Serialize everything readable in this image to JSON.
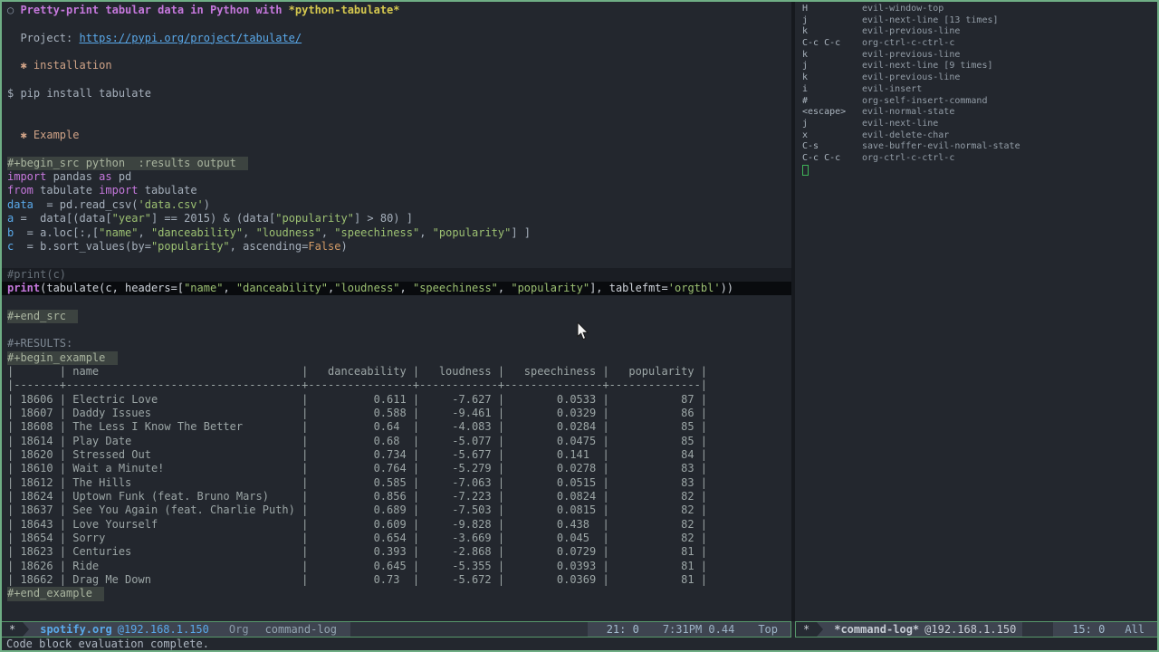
{
  "colors": {
    "background": "#23272e",
    "frame_border": "#6fae85",
    "modeline_bg": "#3e4450",
    "modeline_border": "#57996b",
    "accent_blue": "#5aa9ea",
    "heading_magenta": "#c678dd",
    "string_green": "#9cc072",
    "highlight_yellow": "#d6c94f",
    "cursor_green": "#3fb458"
  },
  "org_buffer": {
    "lines": [
      {
        "s": [
          [
            "bullet",
            "○ "
          ],
          [
            "h1",
            "Pretty-print tabular data in Python with "
          ],
          [
            "yel",
            "*python-tabulate*"
          ]
        ]
      },
      {},
      {
        "s": [
          [
            "t",
            "  Project: "
          ],
          [
            "lnk",
            "https://pypi.org/project/tabulate/"
          ]
        ]
      },
      {},
      {
        "s": [
          [
            "h2",
            "  ✱ installation"
          ]
        ]
      },
      {},
      {
        "s": [
          [
            "t",
            "$ pip install tabulate"
          ]
        ]
      },
      {},
      {},
      {
        "s": [
          [
            "h2",
            "  ✱ Example"
          ]
        ]
      },
      {},
      {
        "chip": "#+begin_src python  :results output "
      },
      {
        "s": [
          [
            "kw",
            "import"
          ],
          [
            "t",
            " pandas "
          ],
          [
            "kw",
            "as"
          ],
          [
            "t",
            " pd"
          ]
        ]
      },
      {
        "s": [
          [
            "kw",
            "from"
          ],
          [
            "t",
            " tabulate "
          ],
          [
            "kw",
            "import"
          ],
          [
            "t",
            " tabulate"
          ]
        ]
      },
      {
        "s": [
          [
            "var",
            "data"
          ],
          [
            "t",
            "  = pd.read_csv("
          ],
          [
            "str",
            "'data.csv'"
          ],
          [
            "t",
            ")"
          ]
        ]
      },
      {
        "s": [
          [
            "var",
            "a"
          ],
          [
            "t",
            " =  data[(data["
          ],
          [
            "str",
            "\"year\""
          ],
          [
            "t",
            "] == 2015) & (data["
          ],
          [
            "str",
            "\"popularity\""
          ],
          [
            "t",
            "] > 80) ]"
          ]
        ]
      },
      {
        "s": [
          [
            "var",
            "b"
          ],
          [
            "t",
            "  = a.loc[:,["
          ],
          [
            "str",
            "\"name\""
          ],
          [
            "t",
            ", "
          ],
          [
            "str",
            "\"danceability\""
          ],
          [
            "t",
            ", "
          ],
          [
            "str",
            "\"loudness\""
          ],
          [
            "t",
            ", "
          ],
          [
            "str",
            "\"speechiness\""
          ],
          [
            "t",
            ", "
          ],
          [
            "str",
            "\"popularity\""
          ],
          [
            "t",
            "] ]"
          ]
        ]
      },
      {
        "s": [
          [
            "var",
            "c"
          ],
          [
            "t",
            "  = b.sort_values(by="
          ],
          [
            "str",
            "\"popularity\""
          ],
          [
            "t",
            ", ascending="
          ],
          [
            "const",
            "False"
          ],
          [
            "t",
            ")"
          ]
        ]
      },
      {},
      {
        "c": "line-cmt",
        "s": [
          [
            "cmt",
            "#print(c)"
          ]
        ]
      },
      {
        "c": "line-print",
        "s": [
          [
            "kwb",
            "print"
          ],
          [
            "t2",
            "(tabulate(c, headers=["
          ],
          [
            "str",
            "\"name\""
          ],
          [
            "t2",
            ", "
          ],
          [
            "str",
            "\"danceability\""
          ],
          [
            "t2",
            ","
          ],
          [
            "str",
            "\"loudness\""
          ],
          [
            "t2",
            ", "
          ],
          [
            "str",
            "\"speechiness\""
          ],
          [
            "t2",
            ", "
          ],
          [
            "str",
            "\"popularity\""
          ],
          [
            "t2",
            "], tablefmt="
          ],
          [
            "str",
            "'orgtbl'"
          ],
          [
            "t2",
            "))"
          ]
        ]
      },
      {},
      {
        "chip": "#+end_src "
      },
      {},
      {
        "s": [
          [
            "dim",
            "#+RESULTS:"
          ]
        ]
      },
      {
        "chip": "#+begin_example "
      },
      {
        "table": true
      },
      {
        "chip": "#+end_example "
      }
    ]
  },
  "results_table": {
    "headers": [
      "",
      "name",
      "danceability",
      "loudness",
      "speechiness",
      "popularity"
    ],
    "rows": [
      [
        "18606",
        "Electric Love",
        "0.611",
        "-7.627",
        "0.0533",
        "87"
      ],
      [
        "18607",
        "Daddy Issues",
        "0.588",
        "-9.461",
        "0.0329",
        "86"
      ],
      [
        "18608",
        "The Less I Know The Better",
        "0.64",
        "-4.083",
        "0.0284",
        "85"
      ],
      [
        "18614",
        "Play Date",
        "0.68",
        "-5.077",
        "0.0475",
        "85"
      ],
      [
        "18620",
        "Stressed Out",
        "0.734",
        "-5.677",
        "0.141",
        "84"
      ],
      [
        "18610",
        "Wait a Minute!",
        "0.764",
        "-5.279",
        "0.0278",
        "83"
      ],
      [
        "18612",
        "The Hills",
        "0.585",
        "-7.063",
        "0.0515",
        "83"
      ],
      [
        "18624",
        "Uptown Funk (feat. Bruno Mars)",
        "0.856",
        "-7.223",
        "0.0824",
        "82"
      ],
      [
        "18637",
        "See You Again (feat. Charlie Puth)",
        "0.689",
        "-7.503",
        "0.0815",
        "82"
      ],
      [
        "18643",
        "Love Yourself",
        "0.609",
        "-9.828",
        "0.438",
        "82"
      ],
      [
        "18654",
        "Sorry",
        "0.654",
        "-3.669",
        "0.045",
        "82"
      ],
      [
        "18623",
        "Centuries",
        "0.393",
        "-2.868",
        "0.0729",
        "81"
      ],
      [
        "18626",
        "Ride",
        "0.645",
        "-5.355",
        "0.0393",
        "81"
      ],
      [
        "18662",
        "Drag Me Down",
        "0.73",
        "-5.672",
        "0.0369",
        "81"
      ]
    ]
  },
  "command_log": {
    "entries": [
      {
        "key": "H",
        "command": "evil-window-top"
      },
      {
        "key": "j",
        "command": "evil-next-line [13 times]"
      },
      {
        "key": "k",
        "command": "evil-previous-line"
      },
      {
        "key": "C-c C-c",
        "command": "org-ctrl-c-ctrl-c"
      },
      {
        "key": "k",
        "command": "evil-previous-line"
      },
      {
        "key": "j",
        "command": "evil-next-line [9 times]"
      },
      {
        "key": "k",
        "command": "evil-previous-line"
      },
      {
        "key": "i",
        "command": "evil-insert"
      },
      {
        "key": "#",
        "command": "org-self-insert-command"
      },
      {
        "key": "<escape>",
        "command": "evil-normal-state"
      },
      {
        "key": "j",
        "command": "evil-next-line"
      },
      {
        "key": "x",
        "command": "evil-delete-char"
      },
      {
        "key": "C-s",
        "command": "save-buffer-evil-normal-state"
      },
      {
        "key": "C-c C-c",
        "command": "org-ctrl-c-ctrl-c"
      }
    ]
  },
  "modeline_left": {
    "status": "*",
    "buffer": "spotify.org",
    "host": "@192.168.1.150",
    "mode_org": "Org",
    "mode_commandlog": "command-log",
    "position": "21: 0",
    "time": "7:31PM 0.44",
    "scroll": "Top"
  },
  "modeline_right": {
    "status": "*",
    "buffer": "*command-log*",
    "host": "@192.168.1.150",
    "position": "15: 0",
    "scroll": "All"
  },
  "echo": {
    "message": "Code block evaluation complete."
  }
}
